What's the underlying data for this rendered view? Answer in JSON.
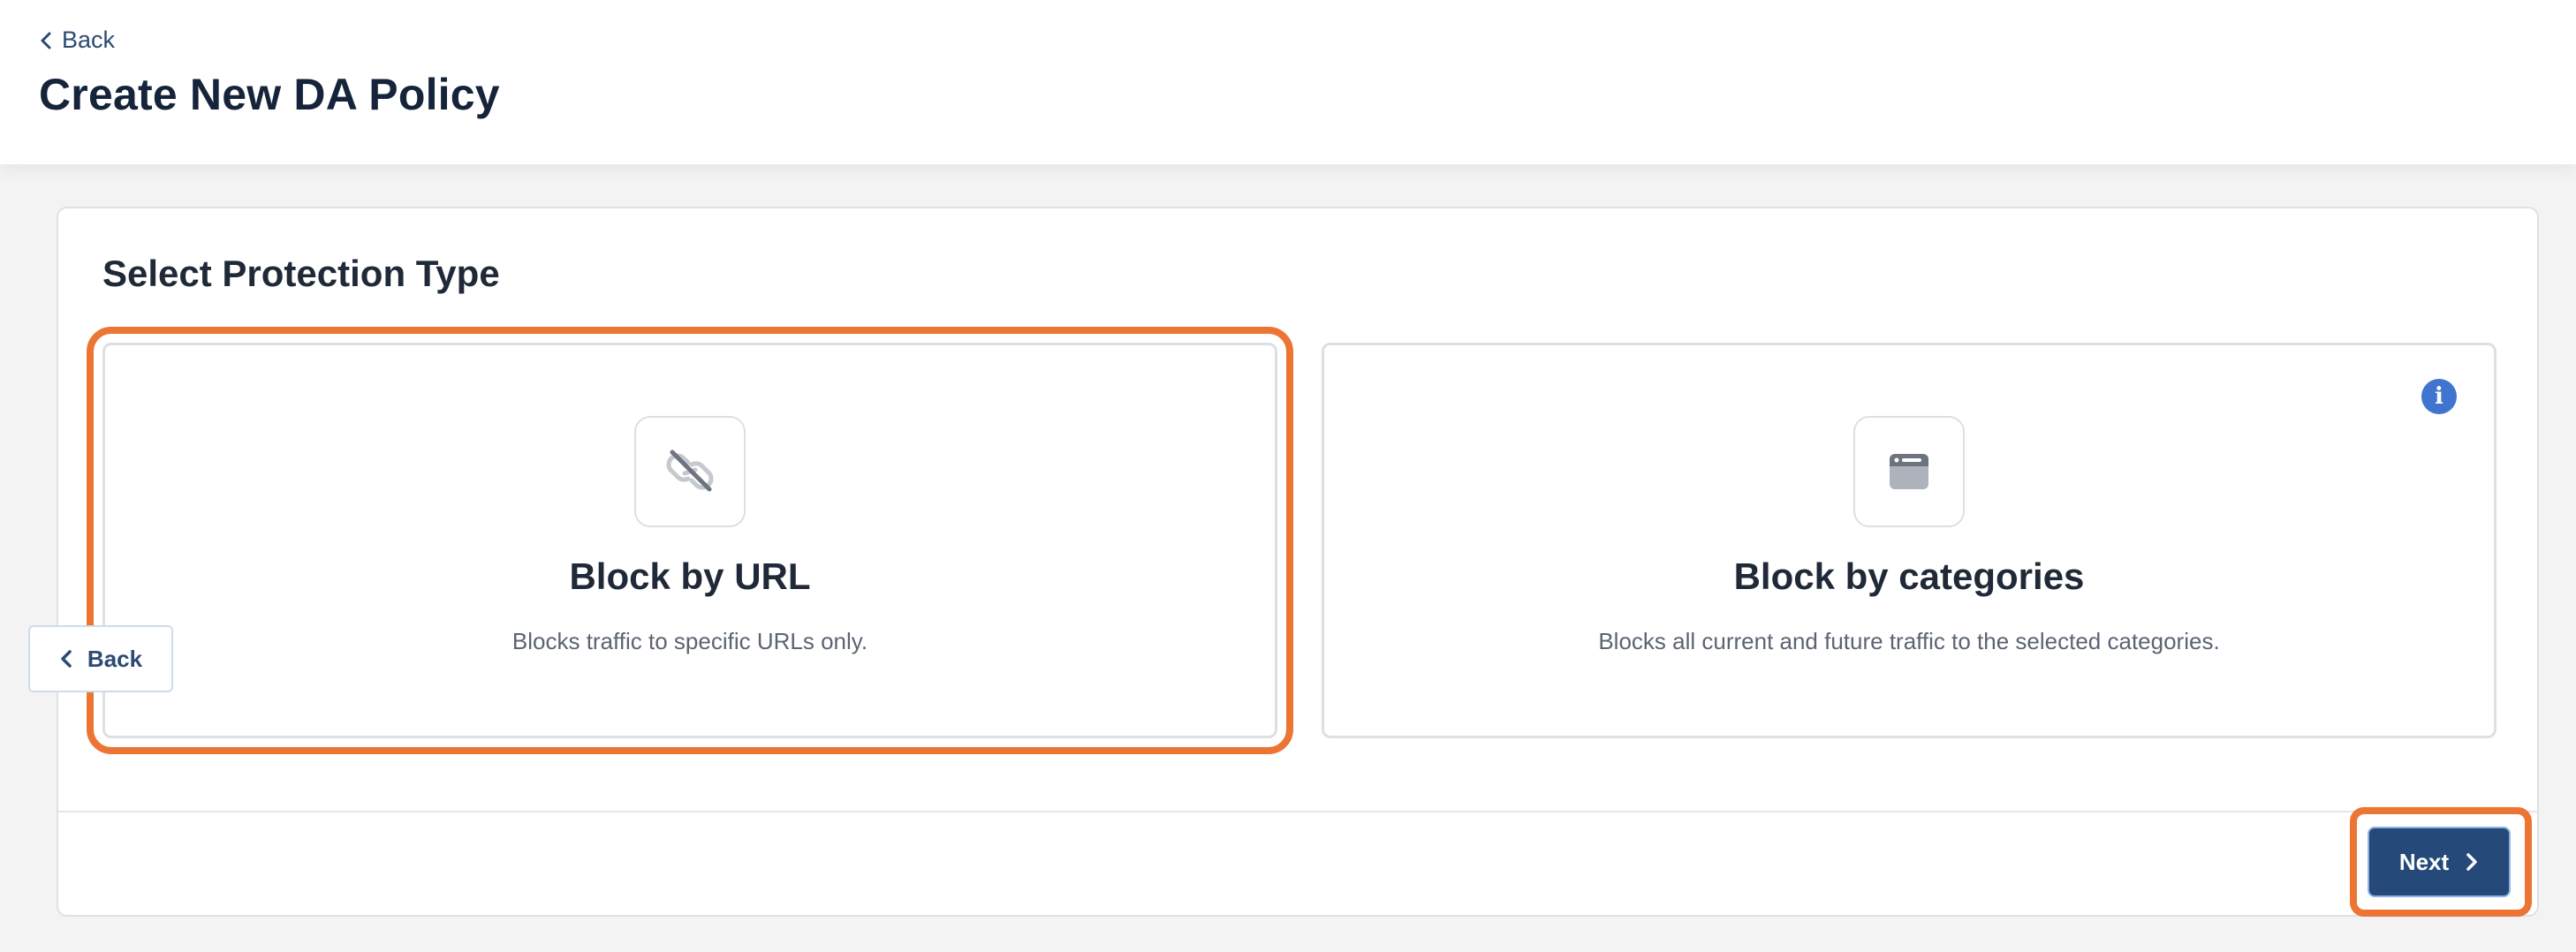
{
  "header": {
    "back_label": "Back",
    "title": "Create New DA Policy"
  },
  "card": {
    "section_title": "Select Protection Type",
    "options": [
      {
        "label": "Block by URL",
        "description": "Blocks traffic to specific URLs only.",
        "icon": "unlink-icon",
        "selected": true
      },
      {
        "label": "Block by categories",
        "description": "Blocks all current and future traffic to the selected categories.",
        "icon": "browser-window-icon",
        "selected": false,
        "info_icon": "info-icon"
      }
    ]
  },
  "footer": {
    "back_label": "Back",
    "next_label": "Next"
  },
  "colors": {
    "highlight": "#ec7533",
    "primary": "#254a7a",
    "info": "#3f74cf"
  }
}
